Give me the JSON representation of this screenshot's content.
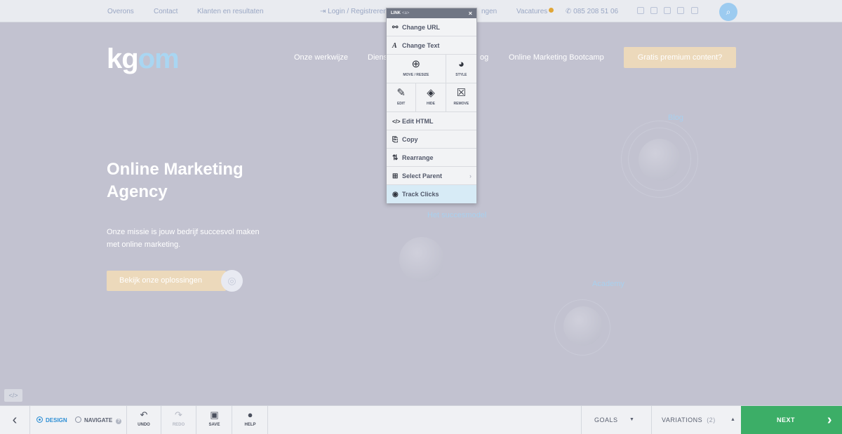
{
  "topbar": {
    "links": [
      "Overons",
      "Contact",
      "Klanten en resultaten"
    ],
    "login": "Login / Registreren",
    "partial_link": "ngen",
    "vacatures": "Vacatures",
    "phone": "085 208 51 06",
    "search_icon": "search-icon"
  },
  "site": {
    "logo_kg": "kg",
    "logo_om": "om",
    "nav": [
      "Onze werkwijze",
      "Dienst",
      "og",
      "Online Marketing Bootcamp"
    ],
    "cta": "Gratis premium content?",
    "hero_title": "Online Marketing Agency",
    "hero_sub": "Onze missie is jouw bedrijf succesvol maken met online marketing.",
    "hero_button": "Bekijk onze oplossingen",
    "labels": {
      "blog": "Blog",
      "succesmodel": "Het succesmodel",
      "academy": "Academy"
    },
    "code_chip": "</>"
  },
  "popup": {
    "title": "LINK",
    "tag": "<a>",
    "close": "×",
    "items_top": [
      {
        "label": "Change URL",
        "icon": "⚯"
      },
      {
        "label": "Change Text",
        "icon": "A"
      }
    ],
    "move_resize": "MOVE / RESIZE",
    "style": "STYLE",
    "edit": "EDIT",
    "hide": "HIDE",
    "remove": "REMOVE",
    "items_bottom": [
      {
        "label": "Edit HTML",
        "icon": "</>"
      },
      {
        "label": "Copy",
        "icon": "⎘"
      },
      {
        "label": "Rearrange",
        "icon": "⇅"
      },
      {
        "label": "Select Parent",
        "icon": "⊞"
      },
      {
        "label": "Track Clicks",
        "icon": "◉"
      }
    ]
  },
  "toolbar": {
    "design": "DESIGN",
    "navigate": "NAVIGATE",
    "undo": "UNDO",
    "redo": "REDO",
    "save": "SAVE",
    "help": "HELP",
    "goals": "GOALS",
    "variations": "VARIATIONS",
    "variations_count": "(2)",
    "next": "NEXT"
  }
}
